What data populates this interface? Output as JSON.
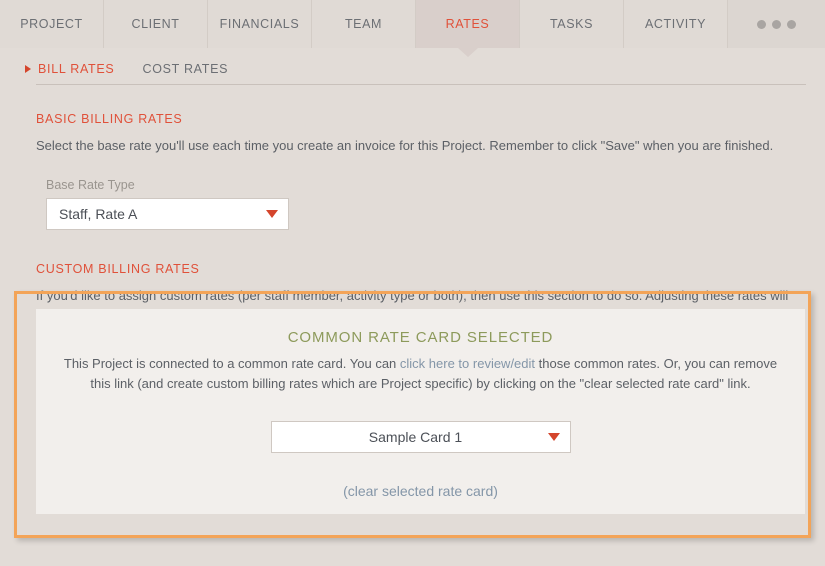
{
  "nav": {
    "tabs": [
      {
        "label": "PROJECT",
        "active": false
      },
      {
        "label": "CLIENT",
        "active": false
      },
      {
        "label": "FINANCIALS",
        "active": false
      },
      {
        "label": "TEAM",
        "active": false
      },
      {
        "label": "RATES",
        "active": true
      },
      {
        "label": "TASKS",
        "active": false
      },
      {
        "label": "ACTIVITY",
        "active": false
      }
    ],
    "overflow_icon": "ellipsis-icon"
  },
  "subtabs": [
    {
      "label": "BILL RATES",
      "active": true
    },
    {
      "label": "COST RATES",
      "active": false
    }
  ],
  "basic": {
    "title": "BASIC BILLING RATES",
    "description": "Select the base rate you'll use each time you create an invoice for this Project. Remember to click \"Save\" when you are finished.",
    "field_label": "Base Rate Type",
    "field_value": "Staff, Rate A"
  },
  "custom": {
    "title": "CUSTOM BILLING RATES",
    "description": "If you'd like to assign custom rates (per staff member, activity type or both), then use this section to do so. Adjusting these rates will automatically apply to any unbilled WIP."
  },
  "panel": {
    "heading": "COMMON RATE CARD SELECTED",
    "text_before_link": "This Project is connected to a common rate card. You can ",
    "link_text": "click here to review/edit",
    "text_after_link": " those common rates. Or, you can remove this link (and create custom billing rates which are Project specific) by clicking on the \"clear selected rate card\" link.",
    "card_value": "Sample Card 1",
    "clear_link": "(clear selected rate card)"
  },
  "colors": {
    "accent_red": "#e0513a",
    "highlight_orange": "#f3a458",
    "panel_green": "#8d9a5b",
    "link_blue": "#8496a8",
    "page_bg": "#e2dcd7"
  }
}
